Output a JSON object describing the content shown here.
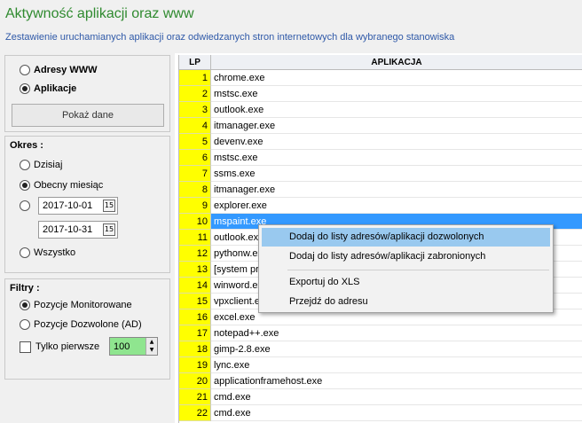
{
  "header": {
    "title": "Aktywność aplikacji oraz www",
    "subtitle": "Zestawienie uruchamianych aplikacji oraz odwiedzanych stron internetowych dla wybranego stanowiska"
  },
  "source": {
    "options": [
      "Adresy WWW",
      "Aplikacje"
    ],
    "selected": "Aplikacje",
    "show_button": "Pokaż dane"
  },
  "period": {
    "title": "Okres :",
    "today": "Dzisiaj",
    "current_month": "Obecny miesiąc",
    "selected": "Obecny miesiąc",
    "date_from": "2017-10-01",
    "date_to": "2017-10-31",
    "all": "Wszystko"
  },
  "filters": {
    "title": "Filtry :",
    "monitored": "Pozycje Monitorowane",
    "allowed": "Pozycje Dozwolone (AD)",
    "selected": "Pozycje Monitorowane",
    "first_only_label": "Tylko pierwsze",
    "first_only_checked": false,
    "first_only_value": "100"
  },
  "grid": {
    "columns": [
      "LP",
      "APLIKACJA"
    ],
    "selected_row": 10,
    "rows": [
      {
        "lp": "1",
        "app": "chrome.exe"
      },
      {
        "lp": "2",
        "app": "mstsc.exe"
      },
      {
        "lp": "3",
        "app": "outlook.exe"
      },
      {
        "lp": "4",
        "app": "itmanager.exe"
      },
      {
        "lp": "5",
        "app": "devenv.exe"
      },
      {
        "lp": "6",
        "app": "mstsc.exe"
      },
      {
        "lp": "7",
        "app": "ssms.exe"
      },
      {
        "lp": "8",
        "app": "itmanager.exe"
      },
      {
        "lp": "9",
        "app": "explorer.exe"
      },
      {
        "lp": "10",
        "app": "mspaint.exe"
      },
      {
        "lp": "11",
        "app": "outlook.ex"
      },
      {
        "lp": "12",
        "app": "pythonw.ex"
      },
      {
        "lp": "13",
        "app": "[system pr"
      },
      {
        "lp": "14",
        "app": "winword.ex"
      },
      {
        "lp": "15",
        "app": "vpxclient.e"
      },
      {
        "lp": "16",
        "app": "excel.exe"
      },
      {
        "lp": "17",
        "app": "notepad++.exe"
      },
      {
        "lp": "18",
        "app": "gimp-2.8.exe"
      },
      {
        "lp": "19",
        "app": "lync.exe"
      },
      {
        "lp": "20",
        "app": "applicationframehost.exe"
      },
      {
        "lp": "21",
        "app": "cmd.exe"
      },
      {
        "lp": "22",
        "app": "cmd.exe"
      }
    ]
  },
  "context_menu": {
    "items": [
      "Dodaj do listy adresów/aplikacji dozwolonych",
      "Dodaj do listy adresów/aplikacji zabronionych",
      "Exportuj do XLS",
      "Przejdź do adresu"
    ],
    "hovered": 0
  },
  "colors": {
    "title": "#2f8a2f",
    "subtitle": "#2f59a8",
    "lp_column": "#ffff00",
    "selection": "#3399ff",
    "menu_hover": "#99c9ef",
    "spin_bg": "#8fe58f"
  },
  "icons": {
    "calendar": "calendar-icon",
    "spin_up": "chevron-up-icon",
    "spin_down": "chevron-down-icon"
  }
}
